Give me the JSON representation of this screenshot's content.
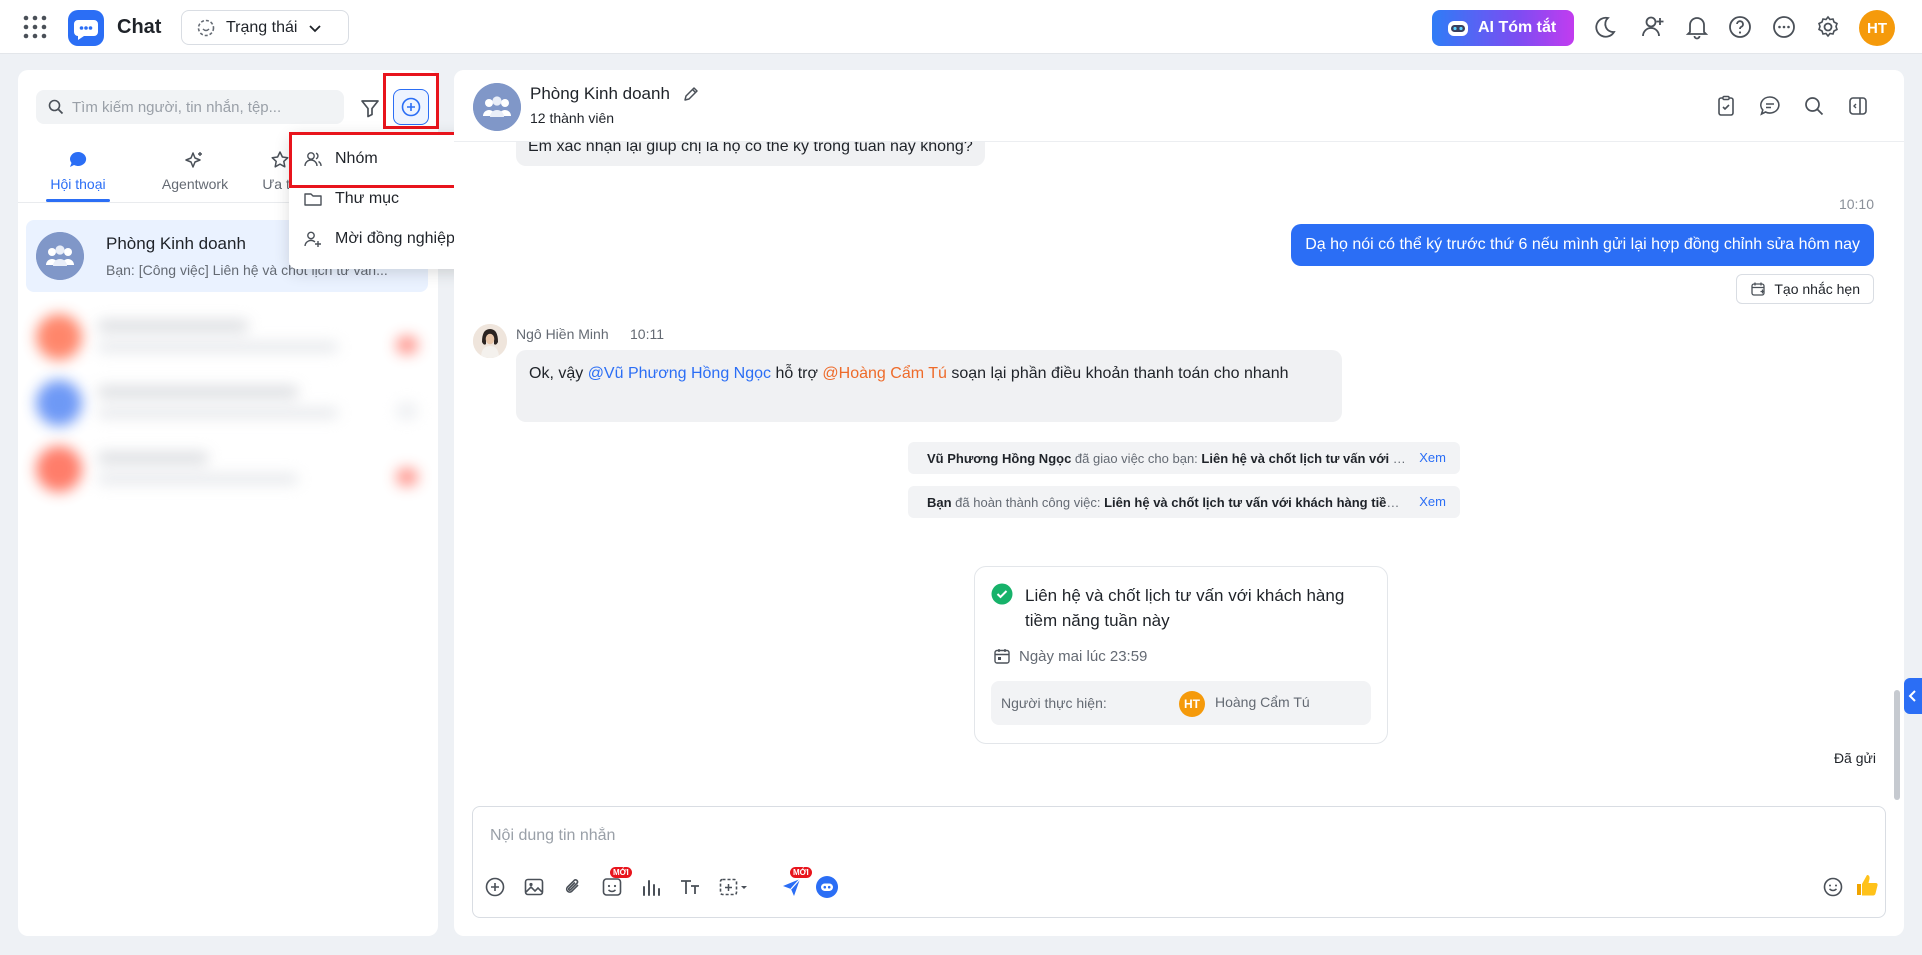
{
  "app": {
    "name": "Chat",
    "status_label": "Trạng thái",
    "ai_summary_label": "AI Tóm tắt",
    "user_initials": "HT"
  },
  "topbar_icons": [
    "moon-icon",
    "add-user-icon",
    "bell-icon",
    "help-icon",
    "more-icon",
    "settings-icon"
  ],
  "sidebar": {
    "search_placeholder": "Tìm kiếm người, tin nhắn, tệp...",
    "tabs": [
      {
        "label": "Hội thoại",
        "icon": "chat-bubble-icon",
        "active": true
      },
      {
        "label": "Agentwork",
        "icon": "sparkle-icon",
        "active": false
      },
      {
        "label": "Ưa th",
        "icon": "star-icon",
        "active": false
      }
    ],
    "conversations": [
      {
        "name": "Phòng Kinh doanh",
        "preview": "Bạn: [Công việc] Liên hệ và chốt lịch tư vấn..."
      }
    ]
  },
  "create_menu": {
    "items": [
      {
        "label": "Nhóm",
        "icon": "group-icon"
      },
      {
        "label": "Thư mục",
        "icon": "folder-icon"
      },
      {
        "label": "Mời đồng nghiệp",
        "icon": "invite-user-icon"
      }
    ]
  },
  "chat": {
    "title": "Phòng Kinh doanh",
    "member_count": "12 thành viên",
    "messages": {
      "previous_text": "Em xác nhận lại giúp chị là họ có thể ký trong tuần này không?",
      "my_time": "10:10",
      "my_text": "Dạ họ nói có thể ký trước thứ 6 nếu mình gửi lại hợp đồng chỉnh sửa hôm nay",
      "reminder_label": "Tạo nhắc hẹn",
      "sender_name": "Ngô Hiền Minh",
      "sender_time": "10:11",
      "their_text_before": "Ok, vậy ",
      "mention_1": "@Vũ Phương Hồng Ngọc",
      "their_text_middle": " hỗ trợ ",
      "mention_2": "@Hoàng Cẩm Tú",
      "their_text_after": " soạn lại phần điều khoản thanh toán cho nhanh"
    },
    "system_events": [
      {
        "actor": "Vũ Phương Hồng Ngọc",
        "action": " đã giao việc cho bạn: ",
        "task": "Liên hệ và chốt lịch tư vấn với khách hàng tiềm năng tuần này",
        "link": "Xem"
      },
      {
        "actor": "Bạn",
        "action": " đã hoàn thành công việc: ",
        "task": "Liên hệ và chốt lịch tư vấn với khách hàng tiềm năng tuần này",
        "link": "Xem"
      }
    ],
    "task_card": {
      "title": "Liên hệ và chốt lịch tư vấn với khách hàng tiềm năng tuần này",
      "due": "Ngày mai lúc 23:59",
      "assignee_label": "Người thực hiện:",
      "assignee_initials": "HT",
      "assignee_name": "Hoàng Cẩm Tú",
      "completed": true
    },
    "sent_status": "Đã gửi",
    "composer": {
      "placeholder": "Nội dung tin nhắn",
      "new_badge": "MỚI"
    }
  },
  "colors": {
    "accent": "#2b6ef5",
    "highlight": "#e8141c",
    "avatar_orange": "#f59a0b",
    "mention_orange": "#ee6b2a"
  }
}
